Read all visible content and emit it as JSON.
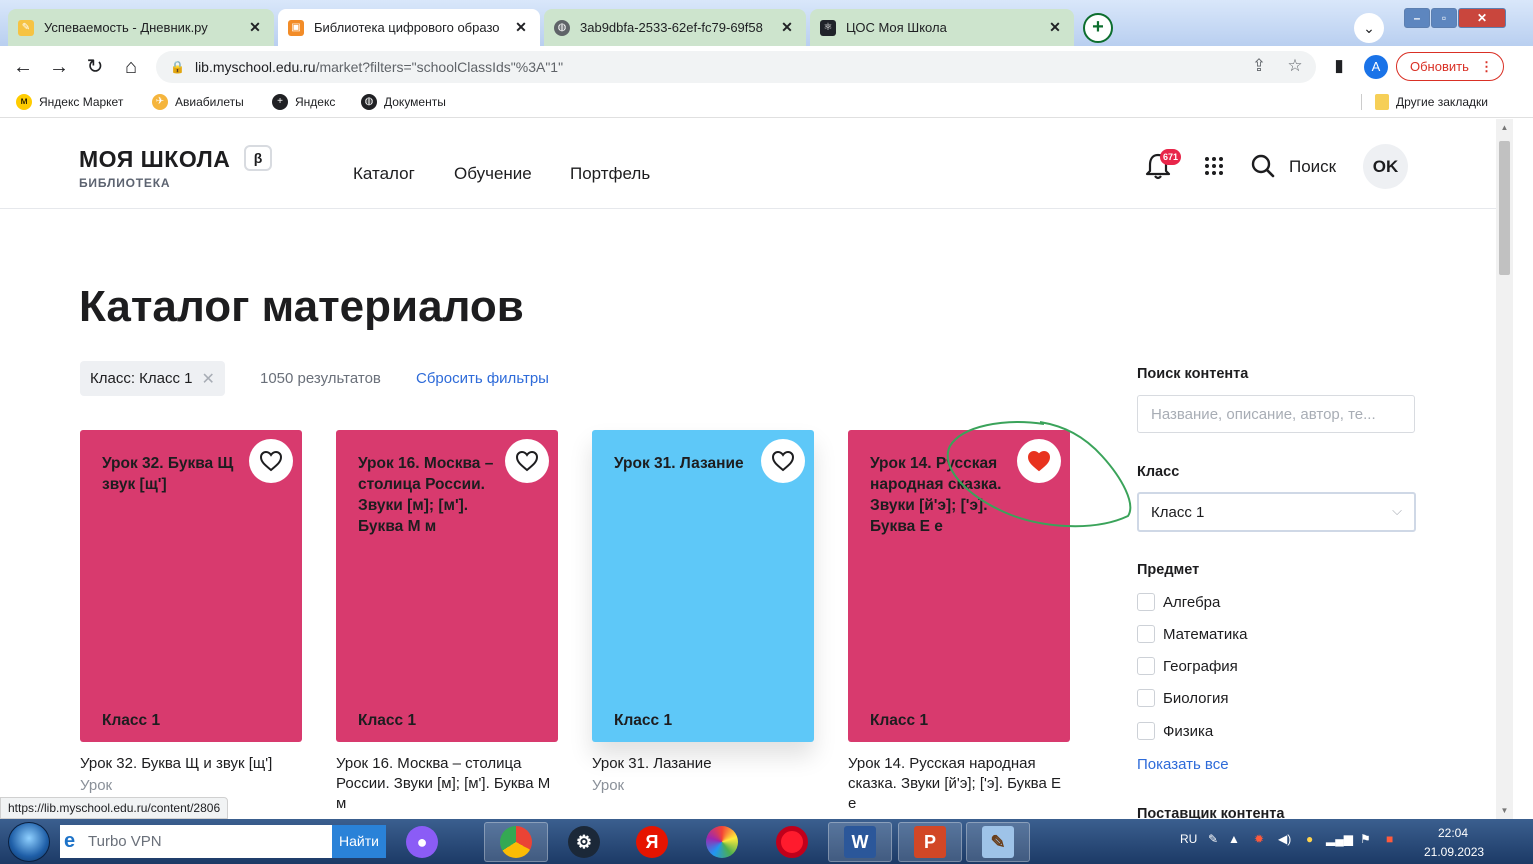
{
  "browser": {
    "tabs": [
      {
        "title": "Успеваемость - Дневник.ру",
        "favicon": "dnevnik-icon",
        "active": false
      },
      {
        "title": "Библиотека цифрового образо",
        "favicon": "myschool-icon",
        "active": true
      },
      {
        "title": "3ab9dbfa-2533-62ef-fc79-69f58",
        "favicon": "globe-icon",
        "active": false
      },
      {
        "title": "ЦОС Моя Школа",
        "favicon": "react-icon",
        "active": false
      }
    ],
    "new_tab": "+",
    "url_host": "lib.myschool.edu.ru",
    "url_path": "/market?filters=\"schoolClassIds\"%3A\"1\"",
    "profile_initial": "A",
    "update_label": "Обновить",
    "bookmarks": [
      "Яндекс Маркет",
      "Авиабилеты",
      "Яндекс",
      "Документы"
    ],
    "other_bookmarks": "Другие закладки",
    "status_url": "https://lib.myschool.edu.ru/content/2806"
  },
  "site": {
    "logo": "МОЯ ШКОЛА",
    "beta": "β",
    "logo_sub": "БИБЛИОТЕКА",
    "nav": [
      "Каталог",
      "Обучение",
      "Портфель"
    ],
    "notification_count": "671",
    "search_label": "Поиск",
    "avatar_initials": "OK"
  },
  "catalog": {
    "title": "Каталог материалов",
    "filter_chip": "Класс: Класс 1",
    "results": "1050 результатов",
    "reset": "Сбросить фильтры",
    "cards": [
      {
        "title": "Урок 32. Буква Щ и звук [щ']",
        "card_title": "Урок 32. Буква Щ звук [щ']",
        "grade": "Класс 1",
        "color": "#d83a6e",
        "favorite": false,
        "caption": "Урок 32. Буква Щ и звук [щ']",
        "type": "Урок"
      },
      {
        "title": "Урок 16. Москва – столица России. Звуки [м]; [м']. Буква М м",
        "card_title": "Урок 16. Москва – столица России. Звуки [м]; [м']. Буква М м",
        "grade": "Класс 1",
        "color": "#d83a6e",
        "favorite": false,
        "caption": "Урок 16. Москва – столица России. Звуки [м]; [м']. Буква М м",
        "type": ""
      },
      {
        "title": "Урок 31. Лазание",
        "card_title": "Урок 31. Лазание",
        "grade": "Класс 1",
        "color": "#5ec8f8",
        "favorite": false,
        "caption": "Урок 31. Лазание",
        "type": "Урок"
      },
      {
        "title": "Урок 14. Русская народная сказка. Звуки [й'э]; ['э]. Буква Е е",
        "card_title": "Урок 14. Русская народная сказка. Звуки [й'э]; ['э]. Буква Е е",
        "grade": "Класс 1",
        "color": "#d83a6e",
        "favorite": true,
        "caption": "Урок 14. Русская народная сказка. Звуки [й'э]; ['э]. Буква Е е",
        "type": ""
      }
    ]
  },
  "sidebar": {
    "search_heading": "Поиск контента",
    "search_placeholder": "Название, описание, автор, те...",
    "class_heading": "Класс",
    "class_value": "Класс 1",
    "subject_heading": "Предмет",
    "subjects": [
      "Алгебра",
      "Математика",
      "География",
      "Биология",
      "Физика"
    ],
    "show_all": "Показать все",
    "provider_heading": "Поставщик контента"
  },
  "taskbar": {
    "search_text": "Turbo VPN",
    "find_button": "Найти",
    "apps": [
      "alice-icon",
      "chrome-icon",
      "steam-icon",
      "yandex-browser-icon",
      "color-wheel-icon",
      "opera-icon",
      "word-icon",
      "powerpoint-icon",
      "paint-icon"
    ],
    "lang": "RU",
    "time": "22:04",
    "date": "21.09.2023"
  }
}
